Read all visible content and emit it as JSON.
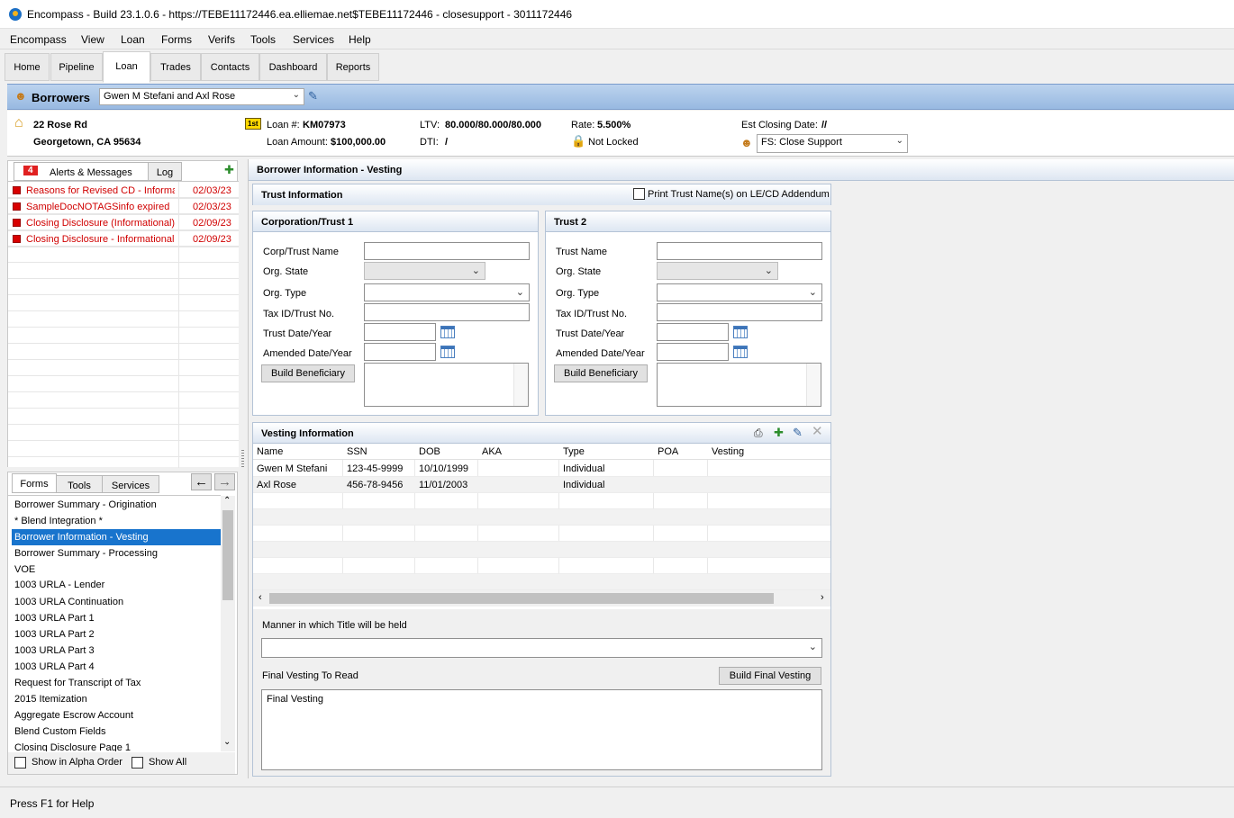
{
  "window": {
    "title": "Encompass - Build 23.1.0.6 - https://TEBE11172446.ea.elliemae.net$TEBE11172446 - closesupport - 3011172446"
  },
  "menu": [
    "Encompass",
    "View",
    "Loan",
    "Forms",
    "Verifs",
    "Tools",
    "Services",
    "Help"
  ],
  "nav_tabs": [
    "Home",
    "Pipeline",
    "Loan",
    "Trades",
    "Contacts",
    "Dashboard",
    "Reports"
  ],
  "active_nav_tab": "Loan",
  "borrowers": {
    "label": "Borrowers",
    "selected": "Gwen M Stefani and Axl Rose"
  },
  "loan_info": {
    "address1": "22 Rose Rd",
    "address2": "Georgetown, CA 95634",
    "lien_badge": "1st",
    "loan_num_label": "Loan #:",
    "loan_num": "KM07973",
    "loan_amount_label": "Loan Amount:",
    "loan_amount": "$100,000.00",
    "ltv_label": "LTV:",
    "ltv": "80.000/80.000/80.000",
    "dti_label": "DTI:",
    "dti": "/",
    "rate_label": "Rate:",
    "rate": "5.500%",
    "lock_status": "Not Locked",
    "closing_label": "Est Closing Date:",
    "closing_date": "//",
    "assignee": "FS: Close Support"
  },
  "alerts": {
    "count": "4",
    "tab_label": "Alerts & Messages",
    "log_tab": "Log",
    "items": [
      {
        "text": "Reasons for Revised CD - Informa",
        "date": "02/03/23"
      },
      {
        "text": "SampleDocNOTAGSinfo expired",
        "date": "02/03/23"
      },
      {
        "text": "Closing Disclosure (Informational)",
        "date": "02/09/23"
      },
      {
        "text": "Closing Disclosure - Informational",
        "date": "02/09/23"
      }
    ]
  },
  "forms_panel": {
    "tabs": [
      "Forms",
      "Tools",
      "Services"
    ],
    "active_tab": "Forms",
    "items": [
      "Borrower Summary - Origination",
      "* Blend Integration *",
      "Borrower Information - Vesting",
      "Borrower Summary - Processing",
      "VOE",
      "1003 URLA - Lender",
      "1003 URLA Continuation",
      "1003 URLA Part 1",
      "1003 URLA Part 2",
      "1003 URLA Part 3",
      "1003 URLA Part 4",
      "Request for Transcript of Tax",
      "2015 Itemization",
      "Aggregate Escrow Account",
      "Blend Custom Fields",
      "Closing Disclosure Page 1"
    ],
    "selected_index": 2,
    "show_alpha": "Show in Alpha Order",
    "show_all": "Show All"
  },
  "form": {
    "title": "Borrower Information - Vesting",
    "trust_info": {
      "title": "Trust Information",
      "print_label": "Print Trust Name(s) on LE/CD Addendum"
    },
    "trust1": {
      "title": "Corporation/Trust 1",
      "name_label": "Corp/Trust Name",
      "state_label": "Org. State",
      "type_label": "Org. Type",
      "taxid_label": "Tax ID/Trust No.",
      "date_label": "Trust Date/Year",
      "amended_label": "Amended Date/Year",
      "build_btn": "Build Beneficiary"
    },
    "trust2": {
      "title": "Trust 2",
      "name_label": "Trust Name",
      "state_label": "Org. State",
      "type_label": "Org. Type",
      "taxid_label": "Tax ID/Trust No.",
      "date_label": "Trust Date/Year",
      "amended_label": "Amended Date/Year",
      "build_btn": "Build Beneficiary"
    },
    "vesting": {
      "title": "Vesting Information",
      "columns": [
        "Name",
        "SSN",
        "DOB",
        "AKA",
        "Type",
        "POA",
        "Vesting"
      ],
      "rows": [
        [
          "Gwen M Stefani",
          "123-45-9999",
          "10/10/1999",
          "",
          "Individual",
          "",
          ""
        ],
        [
          "Axl Rose",
          "456-78-9456",
          "11/01/2003",
          "",
          "Individual",
          "",
          ""
        ]
      ]
    },
    "manner_label": "Manner in which Title will be held",
    "manner_value": "",
    "final_label": "Final Vesting To Read",
    "final_btn": "Build Final Vesting",
    "final_text": "Final Vesting"
  },
  "status": "Press F1 for Help"
}
